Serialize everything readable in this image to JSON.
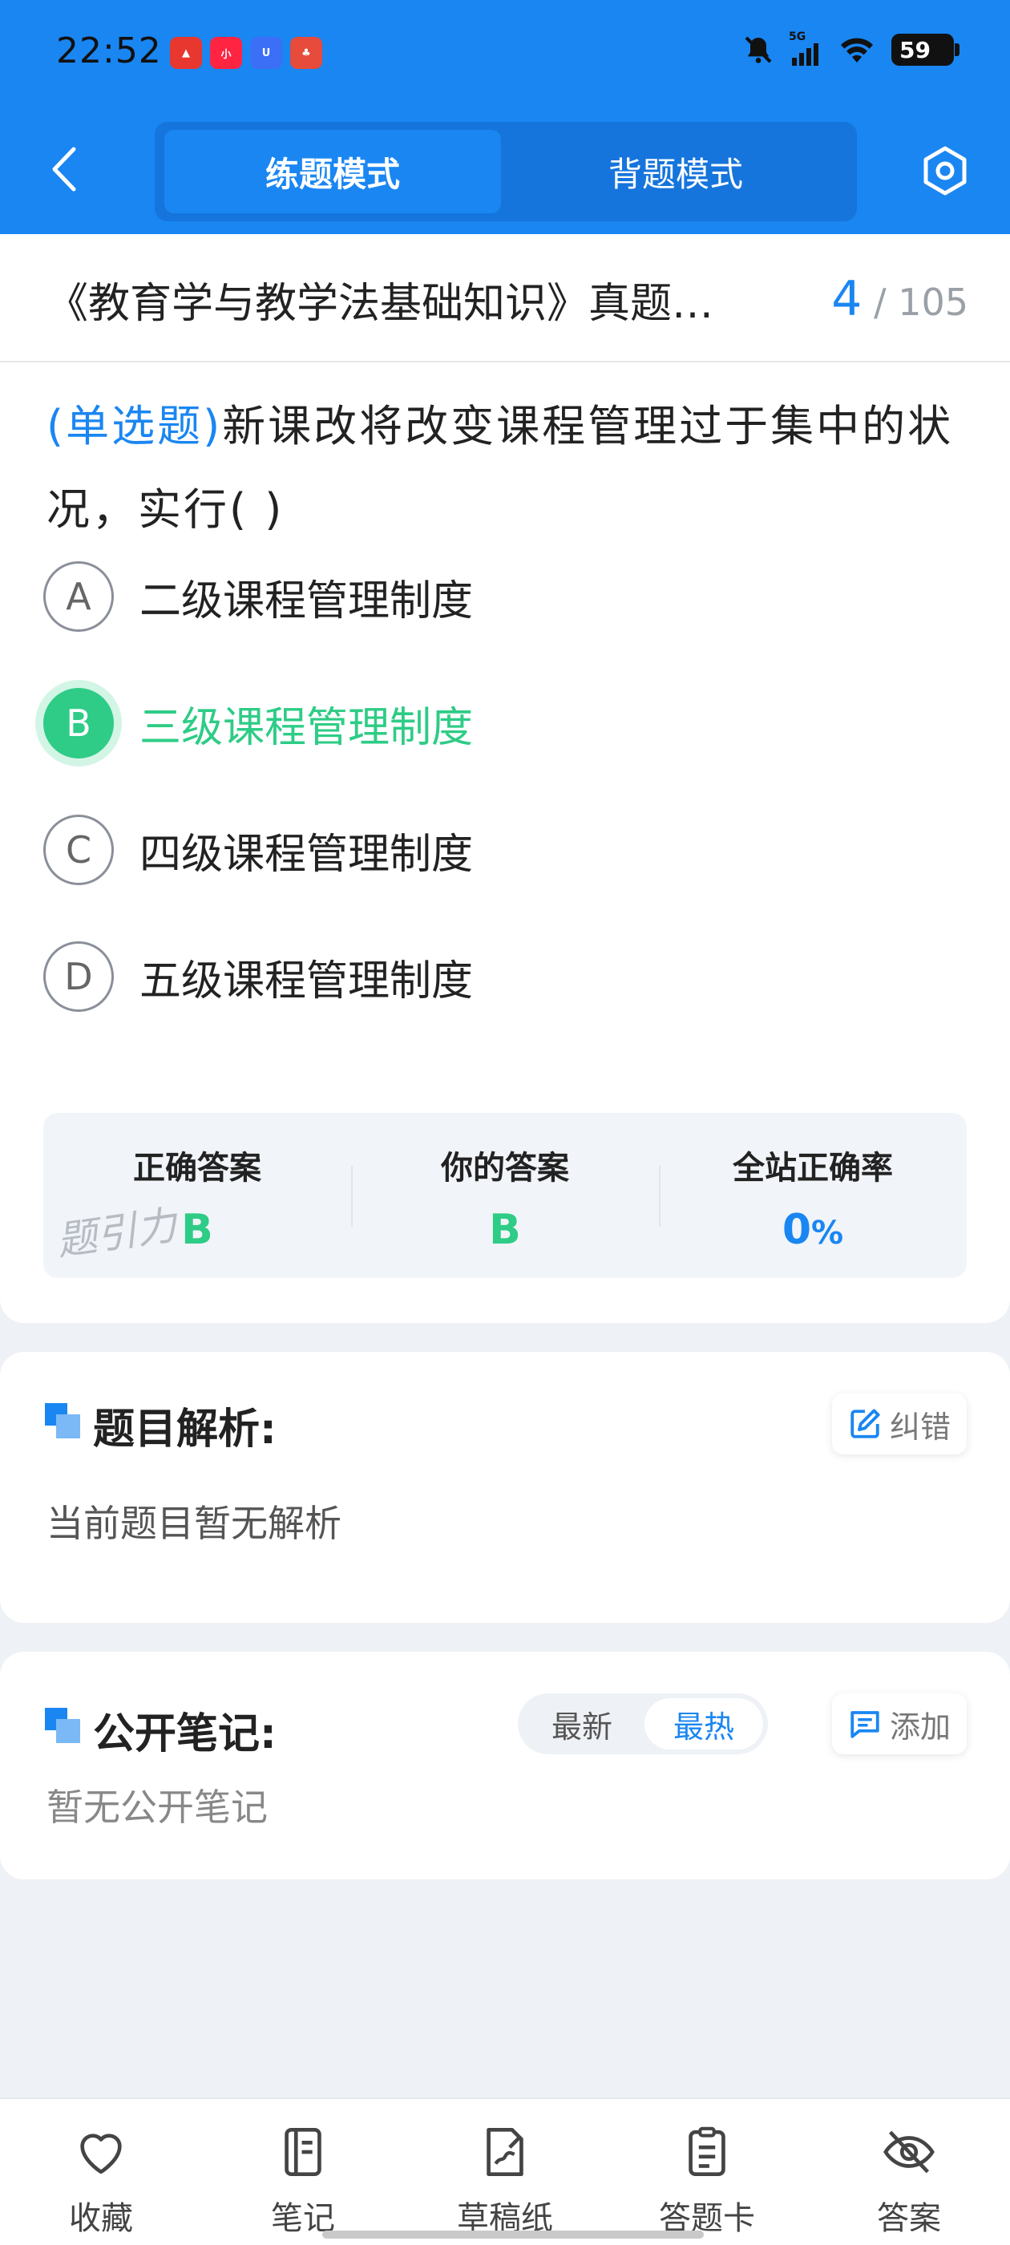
{
  "status_bar": {
    "time": "22:52",
    "apps": [
      {
        "icon": "app-a-icon",
        "color": "#e8372f",
        "label": "A"
      },
      {
        "icon": "xiaohongshu-icon",
        "color": "#ff2442",
        "label": "小红书"
      },
      {
        "icon": "app-u-icon",
        "color": "#3b6ff5",
        "label": "U"
      },
      {
        "icon": "app-game-icon",
        "color": "#e64b3c",
        "label": "游"
      }
    ],
    "network": "5G",
    "battery": "59"
  },
  "header": {
    "tabs": [
      {
        "label": "练题模式",
        "active": true
      },
      {
        "label": "背题模式",
        "active": false
      }
    ]
  },
  "question_header": {
    "title": "《教育学与教学法基础知识》真题…",
    "current": "4",
    "separator": "/",
    "total": "105"
  },
  "question": {
    "type": "(单选题)",
    "text": "新课改将改变课程管理过于集中的状况，实行(        )",
    "options": [
      {
        "letter": "A",
        "text": "二级课程管理制度",
        "state": "normal"
      },
      {
        "letter": "B",
        "text": "三级课程管理制度",
        "state": "correct"
      },
      {
        "letter": "C",
        "text": "四级课程管理制度",
        "state": "normal"
      },
      {
        "letter": "D",
        "text": "五级课程管理制度",
        "state": "normal"
      }
    ]
  },
  "answer_summary": {
    "correct_label": "正确答案",
    "correct_value": "B",
    "yours_label": "你的答案",
    "yours_value": "B",
    "rate_label": "全站正确率",
    "rate_value": "0",
    "rate_unit": "%",
    "watermark": "题引力"
  },
  "analysis": {
    "title": "题目解析:",
    "report_button": "纠错",
    "body": "当前题目暂无解析"
  },
  "notes": {
    "title": "公开笔记:",
    "sort_newest": "最新",
    "sort_hottest": "最热",
    "add_button": "添加",
    "body": "暂无公开笔记"
  },
  "bottom_nav": [
    {
      "label": "收藏",
      "icon": "heart-icon"
    },
    {
      "label": "笔记",
      "icon": "notebook-icon"
    },
    {
      "label": "草稿纸",
      "icon": "draft-paper-icon"
    },
    {
      "label": "答题卡",
      "icon": "answer-card-icon"
    },
    {
      "label": "答案",
      "icon": "eye-off-icon"
    }
  ],
  "colors": {
    "primary": "#1a86f2",
    "correct": "#2ecc86"
  }
}
